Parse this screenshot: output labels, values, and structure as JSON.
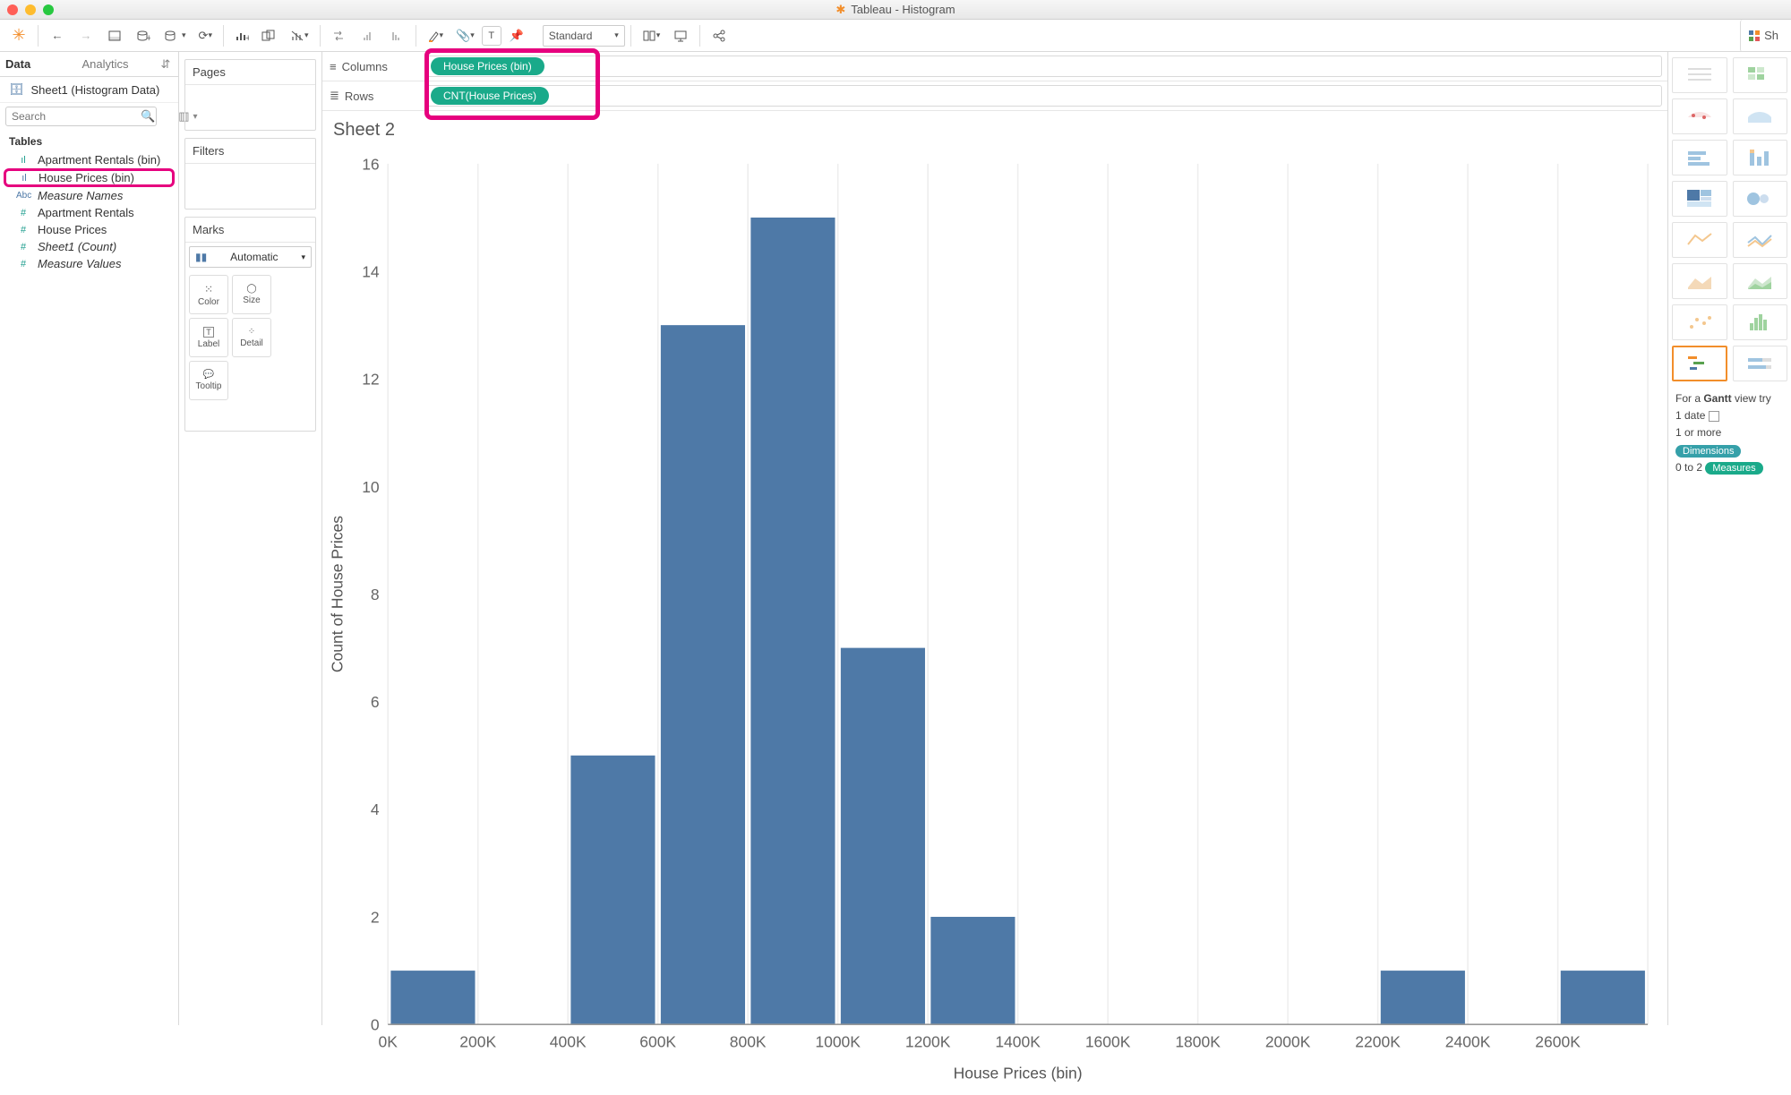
{
  "window_title": "Tableau - Histogram",
  "toolbar_fit": "Standard",
  "show_me_label": "Sh",
  "left_tabs": {
    "data": "Data",
    "analytics": "Analytics"
  },
  "datasource": "Sheet1 (Histogram Data)",
  "search_placeholder": "Search",
  "tables_header": "Tables",
  "fields": {
    "apt_bin": "Apartment Rentals (bin)",
    "house_bin": "House Prices (bin)",
    "measure_names": "Measure Names",
    "apt_rentals": "Apartment Rentals",
    "house_prices": "House Prices",
    "sheet_count": "Sheet1 (Count)",
    "measure_values": "Measure Values"
  },
  "cards": {
    "pages": "Pages",
    "filters": "Filters",
    "marks": "Marks"
  },
  "marks_type": "Automatic",
  "mark_btns": {
    "color": "Color",
    "size": "Size",
    "label": "Label",
    "detail": "Detail",
    "tooltip": "Tooltip"
  },
  "shelves": {
    "columns": "Columns",
    "rows": "Rows"
  },
  "pills": {
    "col": "House Prices (bin)",
    "row": "CNT(House Prices)"
  },
  "sheet_title": "Sheet 2",
  "chart_data": {
    "type": "bar",
    "title": "",
    "xlabel": "House Prices (bin)",
    "ylabel": "Count of House Prices",
    "ylim": [
      0,
      16
    ],
    "yticks": [
      0,
      2,
      4,
      6,
      8,
      10,
      12,
      14,
      16
    ],
    "categories": [
      "0K",
      "200K",
      "400K",
      "600K",
      "800K",
      "1000K",
      "1200K",
      "1400K",
      "1600K",
      "1800K",
      "2000K",
      "2200K",
      "2400K",
      "2600K"
    ],
    "values": [
      1,
      0,
      5,
      13,
      15,
      7,
      2,
      0,
      0,
      0,
      0,
      1,
      0,
      1
    ]
  },
  "showme_hint": {
    "line1_a": "For a ",
    "line1_bold": "Gantt",
    "line1_b": " view try",
    "line2": "1 date",
    "line3a": "1 or more ",
    "tag1": "Dimensions",
    "line4a": "0 to 2 ",
    "tag2": "Measures"
  }
}
